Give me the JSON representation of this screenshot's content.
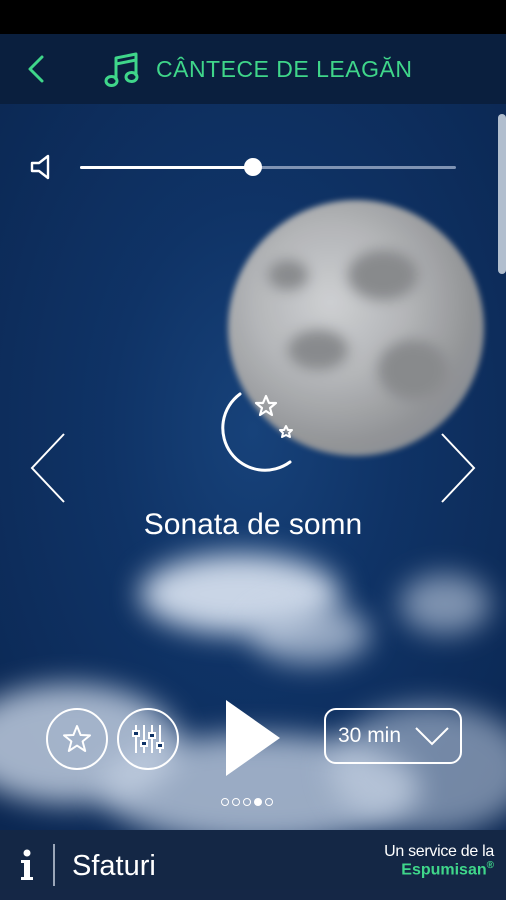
{
  "header": {
    "title": "CÂNTECE DE LEAGĂN",
    "back_icon": "chevron-left-icon",
    "title_icon": "music-note-icon",
    "accent_color": "#3fd68a"
  },
  "player": {
    "volume_percent": 46,
    "song_title": "Sonata de somn",
    "song_icon": "moon-stars-icon",
    "timer": {
      "selected": "30 min"
    },
    "page_dots": {
      "count": 5,
      "active_index": 3
    }
  },
  "footer": {
    "info_icon": "info-icon",
    "tips_label": "Sfaturi",
    "brand_prefix": "Un service de la",
    "brand_name": "Espumisan",
    "brand_mark": "®"
  }
}
